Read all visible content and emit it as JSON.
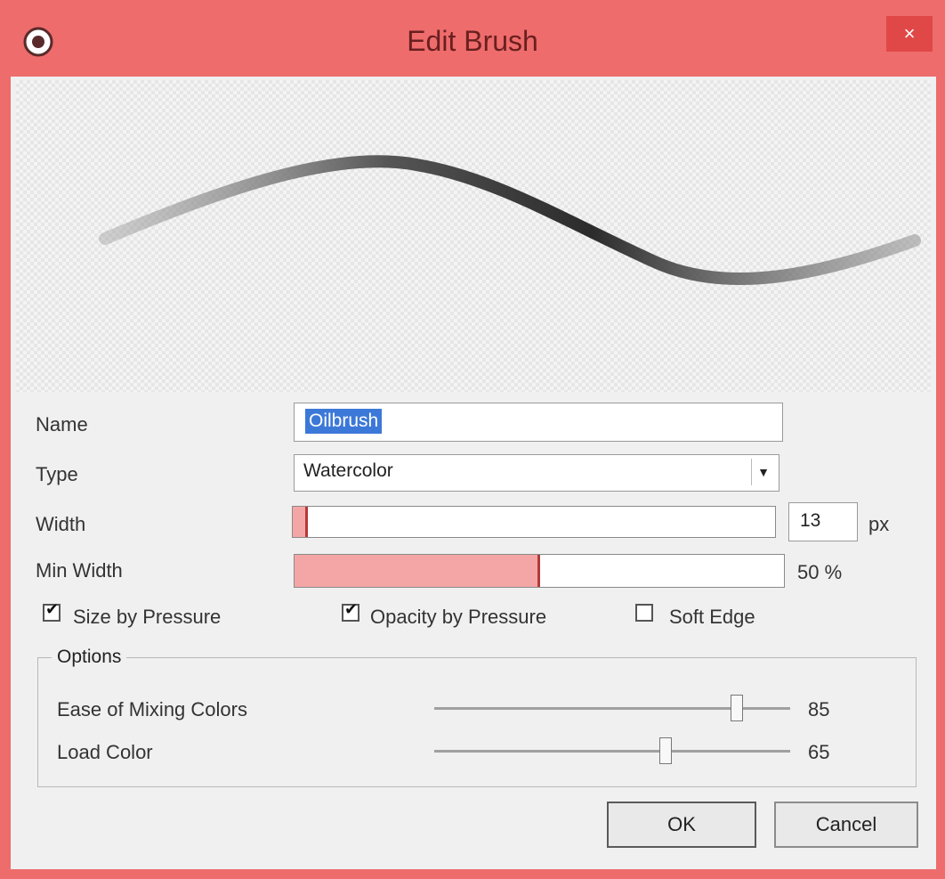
{
  "window": {
    "title": "Edit Brush",
    "close_glyph": "×",
    "accent_color": "#ee6c6c"
  },
  "form": {
    "name_label": "Name",
    "name_value": "Oilbrush",
    "type_label": "Type",
    "type_value": "Watercolor",
    "width_label": "Width",
    "width_value": "13",
    "width_unit": "px",
    "width_fraction": 0.03,
    "min_width_label": "Min Width",
    "min_width_value": "50 %",
    "min_width_fraction": 0.5
  },
  "checkboxes": [
    {
      "label": "Size by Pressure",
      "checked": true
    },
    {
      "label": "Opacity by Pressure",
      "checked": true
    },
    {
      "label": "Soft Edge",
      "checked": false
    }
  ],
  "options": {
    "title": "Options",
    "sliders": [
      {
        "label": "Ease of Mixing Colors",
        "value": "85",
        "fraction": 0.85
      },
      {
        "label": "Load Color",
        "value": "65",
        "fraction": 0.65
      }
    ]
  },
  "buttons": {
    "ok": "OK",
    "cancel": "Cancel"
  },
  "icons": {
    "app": "brush-app-icon",
    "close": "close-icon",
    "dropdown": "chevron-down-icon"
  }
}
